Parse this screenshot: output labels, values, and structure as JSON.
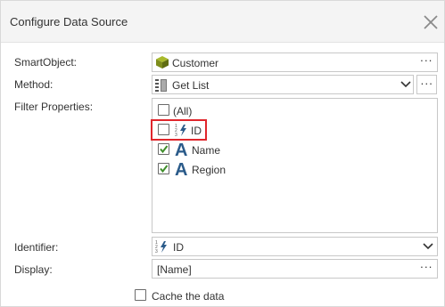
{
  "dialog": {
    "title": "Configure Data Source",
    "close_icon": "close-icon"
  },
  "smartobject": {
    "label": "SmartObject:",
    "value": "Customer",
    "icon": "smartobject-cube-icon",
    "browse_label": "···"
  },
  "method": {
    "label": "Method:",
    "value": "Get List",
    "icon": "list-method-icon",
    "more_label": "···"
  },
  "filter": {
    "label": "Filter Properties:",
    "items": [
      {
        "label": "(All)",
        "checked": false,
        "icon": ""
      },
      {
        "label": "ID",
        "checked": false,
        "icon": "autonumber-icon",
        "highlighted": true,
        "highlight_color": "#e0262c"
      },
      {
        "label": "Name",
        "checked": true,
        "icon": "text-a-icon"
      },
      {
        "label": "Region",
        "checked": true,
        "icon": "text-a-icon"
      }
    ]
  },
  "identifier": {
    "label": "Identifier:",
    "value": "ID",
    "icon": "autonumber-icon"
  },
  "display": {
    "label": "Display:",
    "value": "[Name]",
    "browse_label": "···"
  },
  "cache": {
    "label": "Cache the data",
    "checked": false
  },
  "colors": {
    "checkmark": "#3f8e2b",
    "text_icon": "#2b5b8a",
    "cube": "#8a9a1e",
    "highlight": "#e0262c"
  }
}
